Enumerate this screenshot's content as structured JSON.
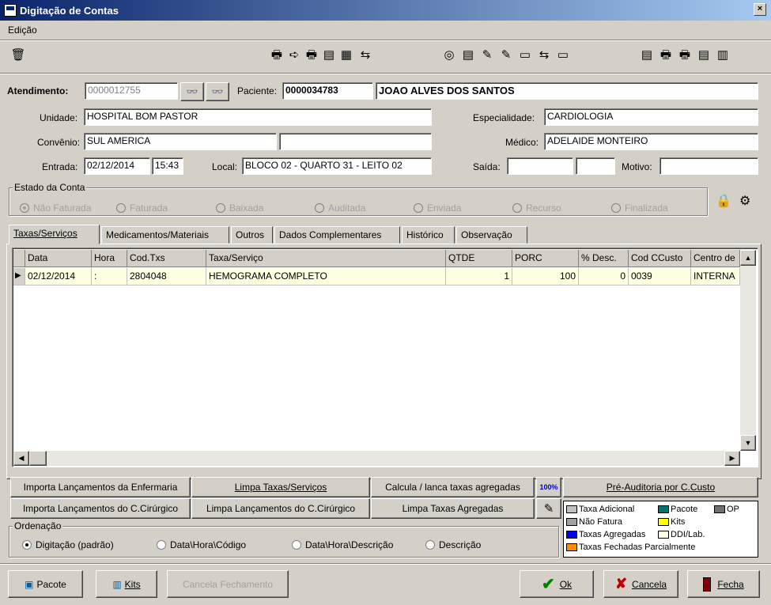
{
  "window": {
    "title": "Digitação de Contas",
    "close": "×"
  },
  "menu": {
    "edicao": "Edição"
  },
  "form": {
    "atendimento_label": "Atendimento:",
    "atendimento": "0000012755",
    "paciente_label": "Paciente:",
    "paciente_id": "0000034783",
    "paciente_nome": "JOAO ALVES DOS SANTOS",
    "unidade_label": "Unidade:",
    "unidade": "HOSPITAL BOM PASTOR",
    "especialidade_label": "Especialidade:",
    "especialidade": "CARDIOLOGIA",
    "convenio_label": "Convênio:",
    "convenio": "SUL AMERICA",
    "convenio2": "",
    "medico_label": "Médico:",
    "medico": "ADELAIDE MONTEIRO",
    "entrada_label": "Entrada:",
    "entrada_data": "02/12/2014",
    "entrada_hora": "15:43",
    "local_label": "Local:",
    "local": "BLOCO 02 - QUARTO 31 - LEITO 02",
    "saida_label": "Saída:",
    "saida_data": "",
    "saida_hora": "",
    "motivo_label": "Motivo:",
    "motivo": ""
  },
  "estado": {
    "label": "Estado da Conta",
    "options": [
      "Não Faturada",
      "Faturada",
      "Baixada",
      "Auditada",
      "Enviada",
      "Recurso",
      "Finalizada"
    ]
  },
  "tabs": [
    "Taxas/Serviços",
    "Medicamentos/Materiais",
    "Outros",
    "Dados Complementares",
    "Histórico",
    "Observação"
  ],
  "grid": {
    "headers": [
      "Data",
      "Hora",
      "Cod.Txs",
      "Taxa/Serviço",
      "QTDE",
      "PORC",
      "% Desc.",
      "Cod CCusto",
      "Centro de"
    ],
    "row": [
      "02/12/2014",
      ":",
      "2804048",
      "HEMOGRAMA COMPLETO",
      "1",
      "100",
      "0",
      "0039",
      "INTERNA"
    ]
  },
  "actions": {
    "importa_enf": "Importa Lançamentos da Enfermaria",
    "limpa_taxas": "Limpa Taxas/Serviços",
    "calcula": "Calcula / lanca taxas agregadas",
    "pct": "100%",
    "pre_auditoria": "Pré-Auditoria por C.Custo",
    "importa_cc": "Importa Lançamentos do C.Cirúrgico",
    "limpa_cc": "Limpa Lançamentos do C.Cirúrgico",
    "limpa_agreg": "Limpa Taxas Agregadas"
  },
  "ordenacao": {
    "label": "Ordenação",
    "options": [
      "Digitação (padrão)",
      "Data\\Hora\\Código",
      "Data\\Hora\\Descrição",
      "Descrição"
    ]
  },
  "legend": {
    "items": [
      {
        "label": "Taxa Adicional",
        "color": "#c0c0c0"
      },
      {
        "label": "Pacote",
        "color": "#00736e"
      },
      {
        "label": "OP",
        "color": "#707070"
      },
      {
        "label": "Não Fatura",
        "color": "#a0a0a0"
      },
      {
        "label": "Kits",
        "color": "#ffff00"
      },
      {
        "label": "Taxas Agregadas",
        "color": "#0000ff"
      },
      {
        "label": "DDI/Lab.",
        "color": "#ffffe1"
      },
      {
        "label": "Taxas Fechadas Parcialmente",
        "color": "#ff8c00"
      }
    ]
  },
  "footer": {
    "pacote": "Pacote",
    "kits": "Kits",
    "cancela_fech": "Cancela Fechamento",
    "ok": "Ok",
    "cancela": "Cancela",
    "fecha": "Fecha"
  }
}
